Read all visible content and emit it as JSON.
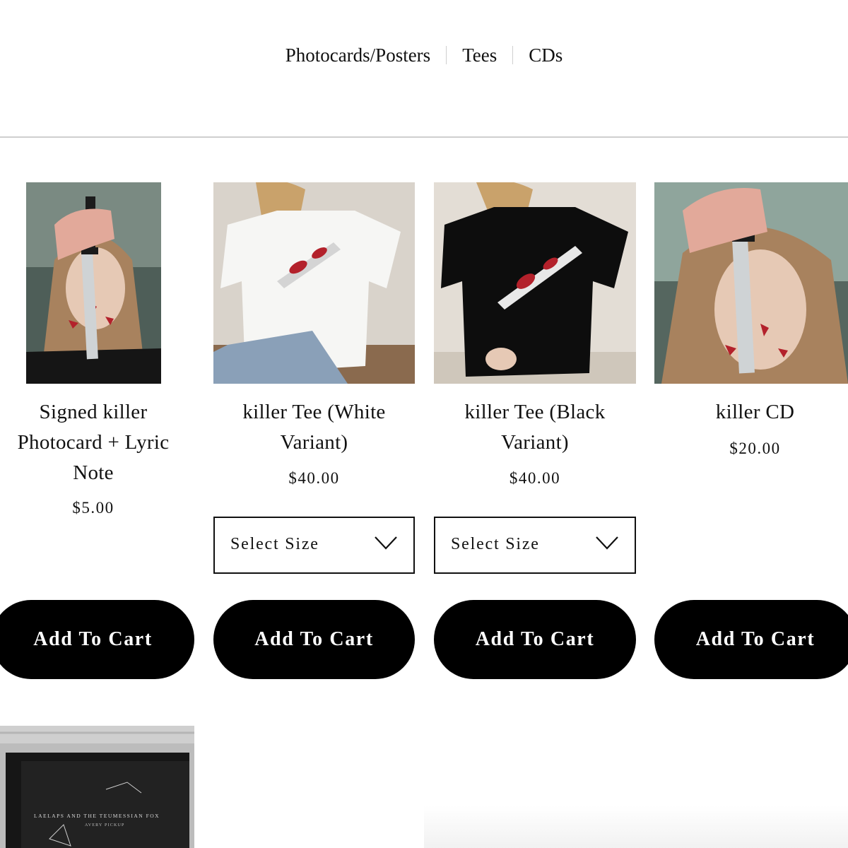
{
  "nav": {
    "categories": [
      {
        "label": "Photocards/Posters"
      },
      {
        "label": "Tees"
      },
      {
        "label": "CDs"
      }
    ]
  },
  "products": [
    {
      "title_lines": [
        "Signed killer",
        "Photocard + Lyric",
        "Note"
      ],
      "price": "$5.00",
      "button": "Add To Cart",
      "has_size": false
    },
    {
      "title_lines": [
        "killer Tee (White",
        "Variant)"
      ],
      "price": "$40.00",
      "size_label": "Select Size",
      "button": "Add To Cart",
      "has_size": true,
      "shirt_color": "#ffffff"
    },
    {
      "title_lines": [
        "killer Tee (Black",
        "Variant)"
      ],
      "price": "$40.00",
      "size_label": "Select Size",
      "button": "Add To Cart",
      "has_size": true,
      "shirt_color": "#0d0d0d"
    },
    {
      "title_lines": [
        "killer CD"
      ],
      "price": "$20.00",
      "button": "Add To Cart",
      "has_size": false
    }
  ],
  "next_product": {
    "cd_cover_lines": [
      "LAELAPS AND THE TEUMESSIAN FOX",
      "AVERY PICKUP"
    ]
  },
  "colors": {
    "button_bg": "#000000",
    "button_text": "#ffffff",
    "divider": "#cfcfcf",
    "blood": "#b3212b"
  }
}
